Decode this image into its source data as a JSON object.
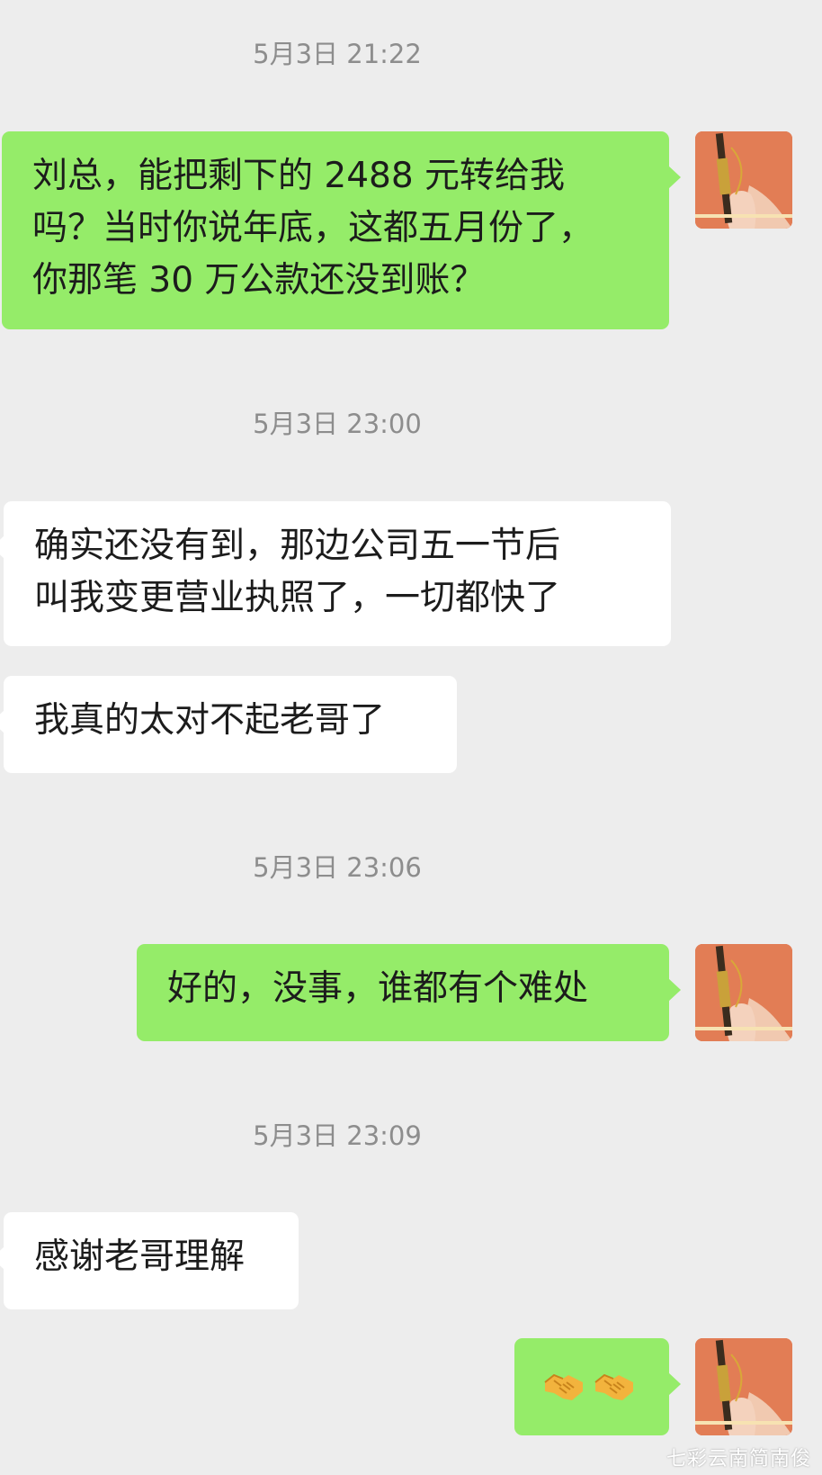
{
  "messages": [
    {
      "time": "5月3日 21:22"
    },
    {
      "me_1": [
        "刘总，能把剩下的 2488 元转给我",
        "吗？当时你说年底，这都五月份了，",
        "你那笔 30 万公款还没到账？"
      ]
    },
    {
      "time": "5月3日 23:00"
    },
    {
      "them_1": [
        "确实还没有到，那边公司五一节后",
        "叫我变更营业执照了，一切都快了"
      ]
    },
    {
      "them_2": [
        "我真的太对不起老哥了"
      ]
    },
    {
      "time": "5月3日 23:06"
    },
    {
      "me_2": [
        "好的，没事，谁都有个难处"
      ]
    },
    {
      "time": "5月3日 23:09"
    },
    {
      "them_3": [
        "感谢老哥理解"
      ]
    },
    {
      "me_3_emoji": [
        "handshake",
        "handshake"
      ]
    }
  ],
  "timestamps": {
    "t1": "5月3日 21:22",
    "t2": "5月3日 23:00",
    "t3": "5月3日 23:06",
    "t4": "5月3日 23:09"
  },
  "bubbles": {
    "me_1": {
      "line1": "刘总，能把剩下的 2488 元转给我",
      "line2": "吗？当时你说年底，这都五月份了，",
      "line3": "你那笔 30 万公款还没到账？"
    },
    "them_1": {
      "line1": "确实还没有到，那边公司五一节后",
      "line2": "叫我变更营业执照了，一切都快了"
    },
    "them_2": {
      "line1": "我真的太对不起老哥了"
    },
    "me_2": {
      "line1": "好的，没事，谁都有个难处"
    },
    "them_3": {
      "line1": "感谢老哥理解"
    },
    "me_3": {
      "emoji": "🤝🤝"
    }
  },
  "icons": {
    "avatar": "avatar-icon",
    "handshake": "handshake-icon"
  },
  "colors": {
    "background": "#ededed",
    "my_bubble": "#95ec69",
    "their_bubble": "#ffffff",
    "timestamp_text": "#8d8d8d",
    "avatar_bg": "#e27d55"
  },
  "watermark": "七彩云南简南俊"
}
